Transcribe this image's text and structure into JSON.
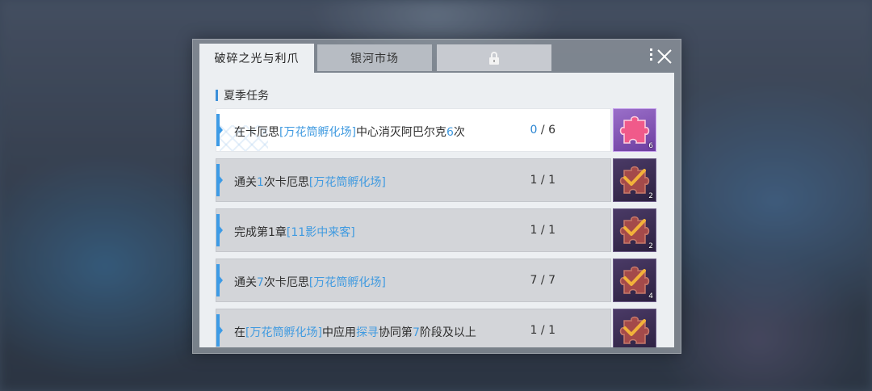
{
  "tabs": [
    {
      "label": "破碎之光与利爪",
      "active": true
    },
    {
      "label": "银河市场",
      "active": false
    },
    {
      "label": "",
      "locked": true
    }
  ],
  "section_title": "夏季任务",
  "tasks": [
    {
      "parts": [
        {
          "text": "在卡厄思",
          "hl": false
        },
        {
          "text": "[万花筒孵化场]",
          "hl": true
        },
        {
          "text": "中心消灭阿巴尔克",
          "hl": false
        },
        {
          "text": "6",
          "hl": true
        },
        {
          "text": "次",
          "hl": false
        }
      ],
      "progress_current": "0",
      "progress_sep": " / ",
      "progress_total": "6",
      "completed": false,
      "reward_qty": "6"
    },
    {
      "parts": [
        {
          "text": "通关",
          "hl": false
        },
        {
          "text": "1",
          "hl": true
        },
        {
          "text": "次卡厄思",
          "hl": false
        },
        {
          "text": "[万花筒孵化场]",
          "hl": true
        }
      ],
      "progress_current": "1",
      "progress_sep": " / ",
      "progress_total": "1",
      "completed": true,
      "reward_qty": "2"
    },
    {
      "parts": [
        {
          "text": "完成第1章",
          "hl": false
        },
        {
          "text": "[11影中来客]",
          "hl": true
        }
      ],
      "progress_current": "1",
      "progress_sep": " / ",
      "progress_total": "1",
      "completed": true,
      "reward_qty": "2"
    },
    {
      "parts": [
        {
          "text": "通关",
          "hl": false
        },
        {
          "text": "7",
          "hl": true
        },
        {
          "text": "次卡厄思",
          "hl": false
        },
        {
          "text": "[万花筒孵化场]",
          "hl": true
        }
      ],
      "progress_current": "7",
      "progress_sep": " / ",
      "progress_total": "7",
      "completed": true,
      "reward_qty": "4"
    },
    {
      "parts": [
        {
          "text": "在",
          "hl": false
        },
        {
          "text": "[万花筒孵化场]",
          "hl": true
        },
        {
          "text": "中应用",
          "hl": false
        },
        {
          "text": "探寻",
          "hl": true
        },
        {
          "text": "协同第",
          "hl": false
        },
        {
          "text": "7",
          "hl": true
        },
        {
          "text": "阶段及以上",
          "hl": false
        }
      ],
      "progress_current": "1",
      "progress_sep": " / ",
      "progress_total": "1",
      "completed": true,
      "reward_qty": ""
    }
  ],
  "colors": {
    "accent": "#3d9be6",
    "highlight_text": "#3f9ae0",
    "reward_claimed": "#2c2140",
    "reward_unclaimed": "#9a6fc9",
    "check": "#f2b23a"
  },
  "icons": {
    "reward": "puzzle-piece-icon",
    "claimed": "checkmark-icon",
    "lock": "lock-icon",
    "close": "close-icon"
  }
}
